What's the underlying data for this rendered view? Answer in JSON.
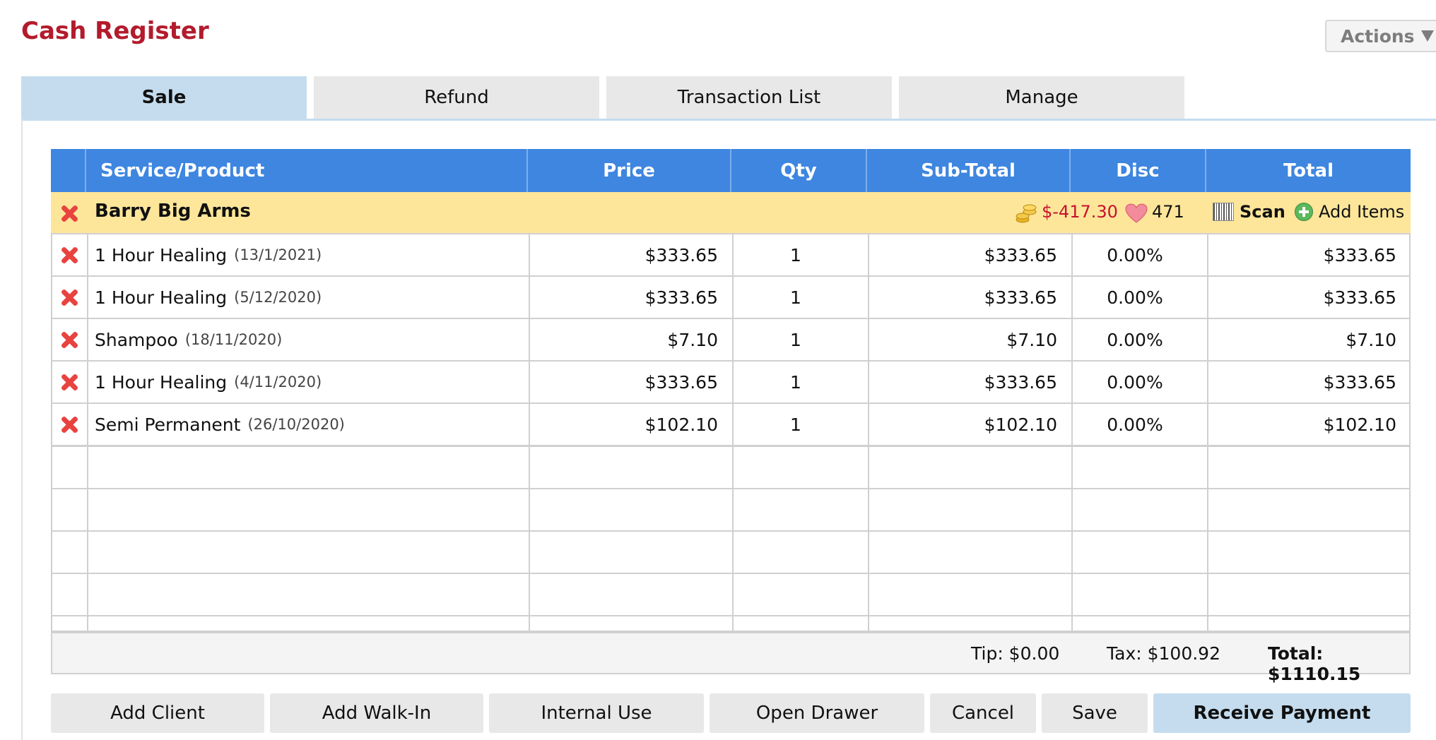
{
  "page": {
    "title": "Cash Register"
  },
  "actions": {
    "label": "Actions",
    "icon": "triangle-down-icon"
  },
  "tabs": [
    {
      "label": "Sale",
      "active": true
    },
    {
      "label": "Refund",
      "active": false
    },
    {
      "label": "Transaction List",
      "active": false
    },
    {
      "label": "Manage",
      "active": false
    }
  ],
  "table": {
    "columns": [
      "",
      "Service/Product",
      "Price",
      "Qty",
      "Sub-Total",
      "Disc",
      "Total"
    ],
    "client": {
      "name": "Barry Big Arms",
      "balance": "$-417.30",
      "points": "471",
      "scan_label": "Scan",
      "add_items_label": "Add Items"
    },
    "rows": [
      {
        "name": "1 Hour Healing",
        "date": "(13/1/2021)",
        "price": "$333.65",
        "qty": "1",
        "subtotal": "$333.65",
        "disc": "0.00%",
        "total": "$333.65"
      },
      {
        "name": "1 Hour Healing",
        "date": "(5/12/2020)",
        "price": "$333.65",
        "qty": "1",
        "subtotal": "$333.65",
        "disc": "0.00%",
        "total": "$333.65"
      },
      {
        "name": "Shampoo",
        "date": "(18/11/2020)",
        "price": "$7.10",
        "qty": "1",
        "subtotal": "$7.10",
        "disc": "0.00%",
        "total": "$7.10"
      },
      {
        "name": "1 Hour Healing",
        "date": "(4/11/2020)",
        "price": "$333.65",
        "qty": "1",
        "subtotal": "$333.65",
        "disc": "0.00%",
        "total": "$333.65"
      },
      {
        "name": "Semi Permanent",
        "date": "(26/10/2020)",
        "price": "$102.10",
        "qty": "1",
        "subtotal": "$102.10",
        "disc": "0.00%",
        "total": "$102.10"
      }
    ]
  },
  "totals": {
    "tip": "Tip: $0.00",
    "tax": "Tax: $100.92",
    "total": "Total: $1110.15"
  },
  "buttons": {
    "add_client": "Add Client",
    "add_walk_in": "Add Walk-In",
    "internal_use": "Internal Use",
    "open_drawer": "Open Drawer",
    "cancel": "Cancel",
    "save": "Save",
    "receive_payment": "Receive Payment"
  },
  "colors": {
    "title": "#b31b2c",
    "header": "#3e86e0",
    "client_row": "#fde69a",
    "active_tab": "#c5dcee",
    "delete": "#e8433f",
    "balance": "#c8102e"
  }
}
